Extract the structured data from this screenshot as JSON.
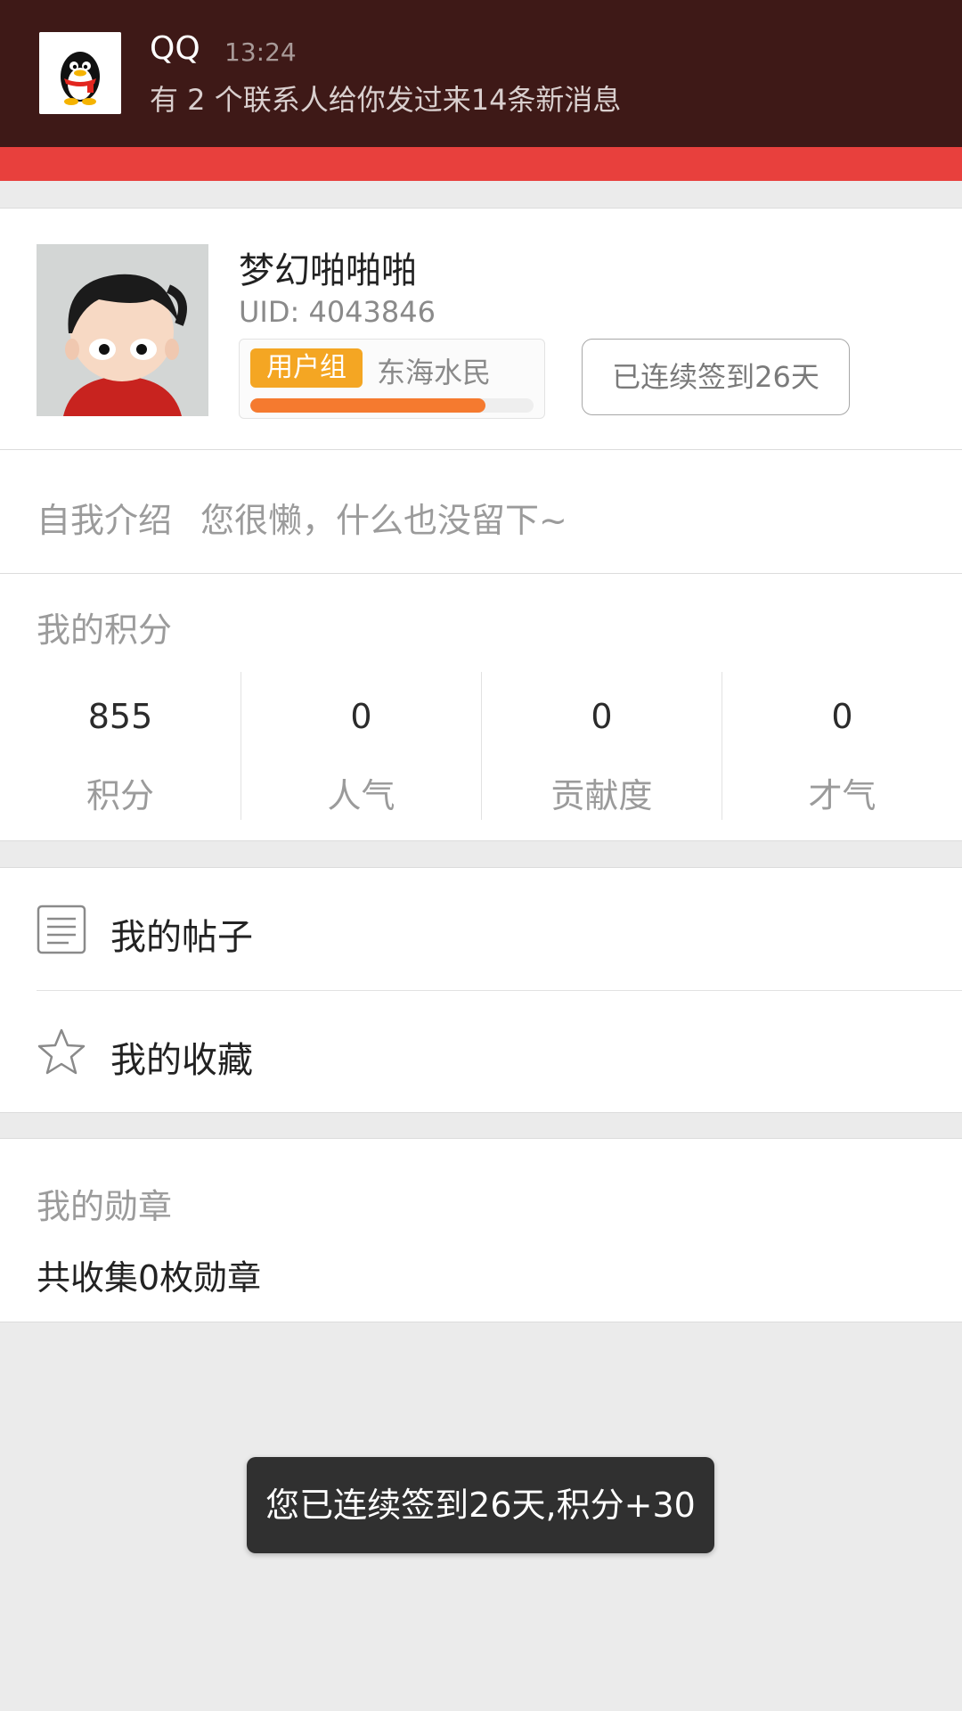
{
  "notification": {
    "app_name": "QQ",
    "time": "13:24",
    "message": "有 2 个联系人给你发过来14条新消息",
    "icon": "qq-penguin-icon"
  },
  "header": {
    "accent_color": "#e8403d"
  },
  "profile": {
    "username": "梦幻啪啪啪",
    "uid": "UID: 4043846",
    "group_badge": "用户组",
    "group_name": "东海水民",
    "group_progress": 0.83,
    "signin_label": "已连续签到26天"
  },
  "intro": {
    "label": "自我介绍",
    "text": "您很懒，什么也没留下~"
  },
  "points": {
    "title": "我的积分",
    "stats": [
      {
        "value": "855",
        "label": "积分"
      },
      {
        "value": "0",
        "label": "人气"
      },
      {
        "value": "0",
        "label": "贡献度"
      },
      {
        "value": "0",
        "label": "才气"
      }
    ]
  },
  "menu": {
    "items": [
      {
        "label": "我的帖子",
        "icon": "document-icon"
      },
      {
        "label": "我的收藏",
        "icon": "star-icon"
      }
    ]
  },
  "medals": {
    "title": "我的勋章",
    "text": "共收集0枚勋章"
  },
  "toast": {
    "text": "您已连续签到26天,积分+30"
  }
}
